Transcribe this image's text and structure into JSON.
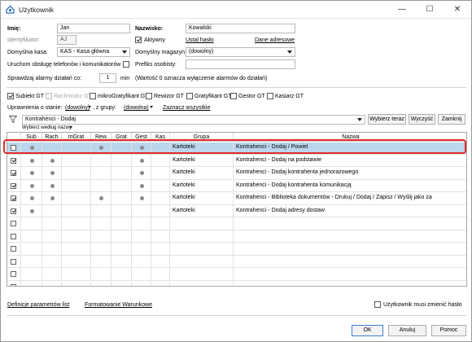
{
  "window": {
    "title": "Użytkownik",
    "minimize": "—",
    "maximize": "☐",
    "close": "✕"
  },
  "form": {
    "imie_label": "Imię:",
    "imie_value": "Jan",
    "nazwisko_label": "Nazwisko:",
    "nazwisko_value": "Kowalski",
    "identyfikator_label": "Identyfikator:",
    "identyfikator_value": "AJ",
    "aktywny_label": "Aktywny",
    "aktywny_checked": true,
    "ustal_haslo": "Ustal hasło",
    "dane_adresowe": "Dane adresowe",
    "kasa_label": "Domyślna kasa:",
    "kasa_value": "KAS - Kasa główna",
    "magazyn_label": "Domyślny magazyn:",
    "magazyn_value": "(dowolny)",
    "telefon_label": "Uruchom obsługę telefonów i komunikatorów",
    "prefiks_label": "Prefiks osobisty:",
    "alarmy_label": "Sprawdzaj alarmy działań co:",
    "alarmy_value": "1",
    "alarmy_unit": "min",
    "alarmy_note": "(Wartość 0 oznacza wyłączenie alarmów do działań)"
  },
  "roles": [
    {
      "label": "Subiekt GT",
      "checked": true,
      "disabled": false
    },
    {
      "label": "Rachmistrz GT",
      "checked": false,
      "disabled": true
    },
    {
      "label": "mikroGratyfikant GT",
      "checked": false,
      "disabled": false
    },
    {
      "label": "Rewizor GT",
      "checked": false,
      "disabled": false
    },
    {
      "label": "Gratyfikant GT",
      "checked": false,
      "disabled": false
    },
    {
      "label": "Gestor GT",
      "checked": false,
      "disabled": false
    },
    {
      "label": "Kasiarz GT",
      "checked": false,
      "disabled": false
    }
  ],
  "filters": {
    "uprawnienia_label": "Uprawnienia o stanie:",
    "stan_value": "(dowolny)",
    "grupy_label": ", z grupy:",
    "grupa_value": "(dowolna)",
    "zaznacz": "Zaznacz wszystkie",
    "search_value": "Kontrahenci - Dodaj",
    "wybierz_teraz": "Wybierz teraz",
    "wyczysc": "Wyczyść",
    "zamknij": "Zamknij",
    "wybierz_wedlug": "Wybierz według nazwy"
  },
  "table": {
    "columns": [
      "Sub",
      "Rach",
      "mGrat",
      "Rew",
      "Grat",
      "Gest",
      "Kas",
      "Grupa",
      "Nazwa"
    ],
    "rows": [
      {
        "checked": false,
        "dots": [
          1,
          0,
          0,
          1,
          0,
          1,
          0
        ],
        "grupa": "Kartoteki",
        "nazwa": "Kontrahenci - Dodaj / Powiel",
        "selected": true
      },
      {
        "checked": true,
        "dots": [
          1,
          1,
          0,
          0,
          0,
          1,
          0
        ],
        "grupa": "Kartoteki",
        "nazwa": "Kontrahenci - Dodaj na podstawie",
        "selected": false
      },
      {
        "checked": true,
        "dots": [
          1,
          1,
          0,
          0,
          0,
          1,
          0
        ],
        "grupa": "Kartoteki",
        "nazwa": "Kontrahenci - Dodaj kontrahenta jednorazowego",
        "selected": false
      },
      {
        "checked": true,
        "dots": [
          1,
          1,
          0,
          0,
          0,
          1,
          0
        ],
        "grupa": "Kartoteki",
        "nazwa": "Kontrahenci - Dodaj kontrahenta komunikacją",
        "selected": false
      },
      {
        "checked": true,
        "dots": [
          1,
          1,
          0,
          1,
          0,
          1,
          0
        ],
        "grupa": "Kartoteki",
        "nazwa": "Kontrahenci - Biblioteka dokumentów - Drukuj / Dodaj / Zapisz / Wyślij jako za",
        "selected": false
      },
      {
        "checked": true,
        "dots": [
          1,
          0,
          0,
          0,
          0,
          0,
          0
        ],
        "grupa": "Kartoteki",
        "nazwa": "Kontrahenci - Dodaj adresy dostaw",
        "selected": false
      }
    ],
    "empty_rows": 6
  },
  "footer": {
    "definicje": "Definicje parametrów list",
    "formatowanie": "Formatowanie Warunkowe",
    "musi_zmienic": "Użytkownik musi zmienić hasło",
    "ok": "OK",
    "anuluj": "Anuluj",
    "pomoc": "Pomoc"
  }
}
